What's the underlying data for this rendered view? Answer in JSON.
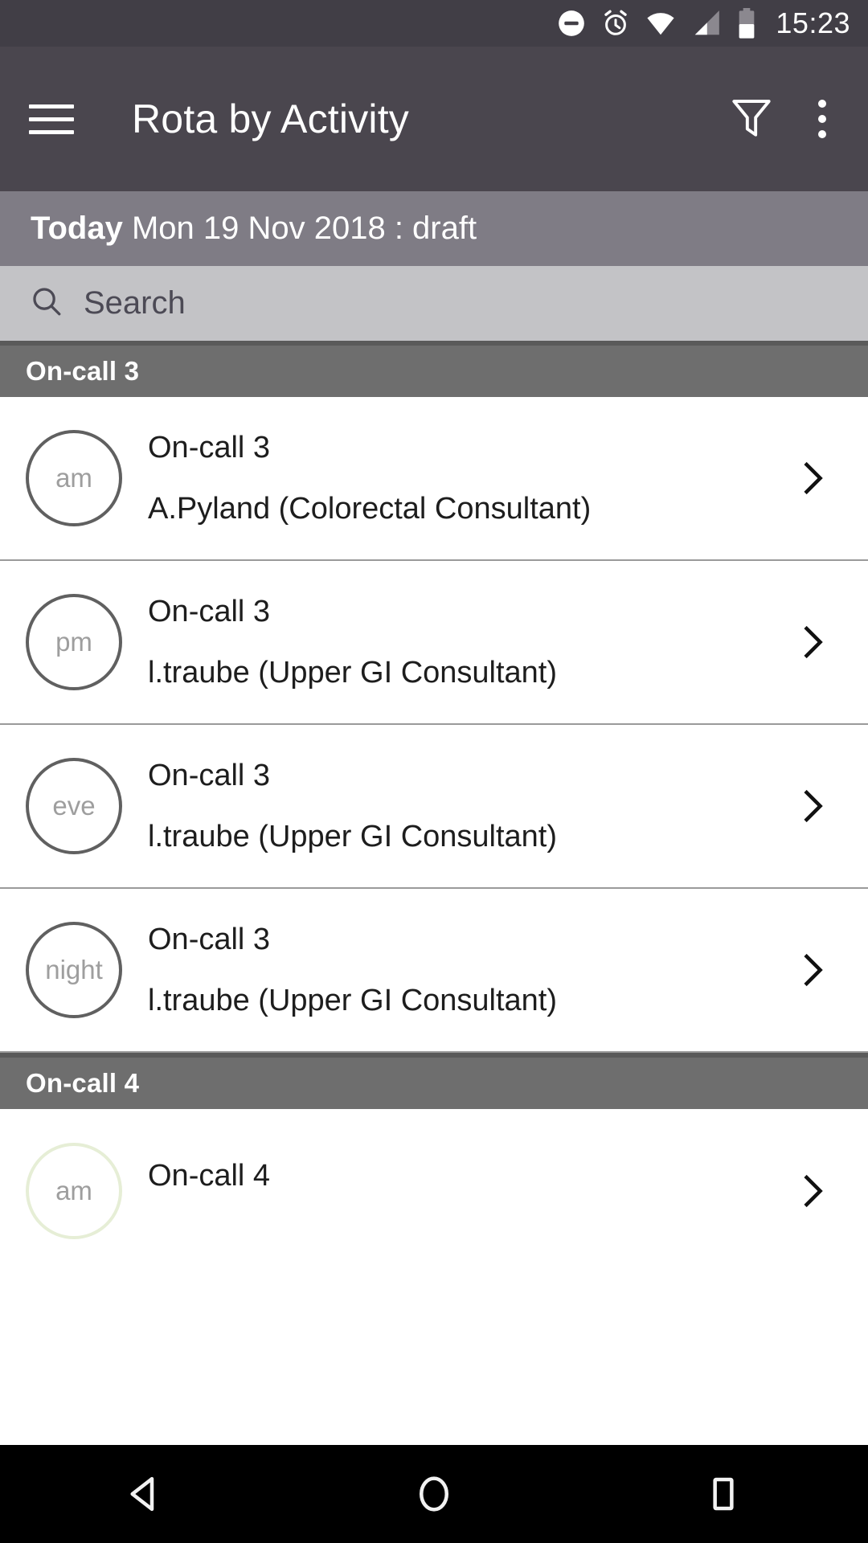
{
  "status_bar": {
    "time": "15:23",
    "icons": [
      "do-not-disturb-icon",
      "alarm-icon",
      "wifi-icon",
      "cell-signal-icon",
      "battery-icon"
    ],
    "battery_level_percent": 50
  },
  "app_bar": {
    "menu_icon": "hamburger-menu-icon",
    "title": "Rota by Activity",
    "filter_icon": "filter-funnel-icon",
    "overflow_icon": "overflow-menu-icon",
    "background_color": "#4a464e"
  },
  "date_bar": {
    "prefix": "Today",
    "date": "Mon 19 Nov 2018 : draft",
    "background_color": "#7f7c85"
  },
  "search": {
    "icon": "search-icon",
    "placeholder": "Search",
    "value": "",
    "background_color": "#c3c3c6"
  },
  "sections": [
    {
      "header": "On-call 3",
      "rows": [
        {
          "period": "am",
          "title": "On-call 3",
          "subtitle": "A.Pyland (Colorectal Consultant)",
          "avatar_color": "#606060"
        },
        {
          "period": "pm",
          "title": "On-call 3",
          "subtitle": "l.traube (Upper GI Consultant)",
          "avatar_color": "#606060"
        },
        {
          "period": "eve",
          "title": "On-call 3",
          "subtitle": "l.traube (Upper GI Consultant)",
          "avatar_color": "#606060"
        },
        {
          "period": "night",
          "title": "On-call 3",
          "subtitle": "l.traube (Upper GI Consultant)",
          "avatar_color": "#606060"
        }
      ]
    },
    {
      "header": "On-call 4",
      "rows": [
        {
          "period": "am",
          "title": "On-call 4",
          "subtitle": "",
          "avatar_color": "#e6eed6"
        }
      ]
    }
  ],
  "nav_bar": {
    "back_icon": "back-triangle-icon",
    "home_icon": "home-circle-icon",
    "recents_icon": "recents-square-icon",
    "background_color": "#000000"
  },
  "section_header_color": "#6e6e6e",
  "row_chevron_icon": "chevron-right-icon"
}
